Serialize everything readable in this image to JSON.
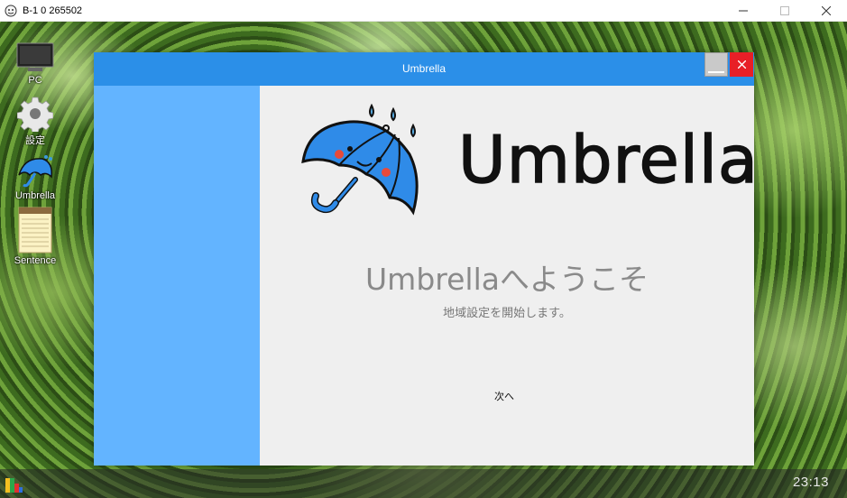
{
  "host_window": {
    "title": "B-1  0 265502",
    "controls": [
      "minimize-icon",
      "maximize-icon",
      "close-icon"
    ]
  },
  "desktop": {
    "icons": [
      {
        "label": "PC",
        "icon": "monitor-icon"
      },
      {
        "label": "設定",
        "icon": "gear-icon"
      },
      {
        "label": "Umbrella",
        "icon": "umbrella-icon"
      },
      {
        "label": "Sentence",
        "icon": "notepad-icon"
      }
    ]
  },
  "taskbar": {
    "clock": "23:13",
    "start_icon": "start-icon"
  },
  "app": {
    "title": "Umbrella",
    "colors": {
      "titlebar": "#2b8fe8",
      "sidebar": "#63b4ff",
      "close": "#e81f27",
      "umbrella": "#2f8be8"
    },
    "logo_text": "Umbrella",
    "welcome": "Umbrellaへようこそ",
    "subtitle": "地域設定を開始します。",
    "next_label": "次へ"
  }
}
